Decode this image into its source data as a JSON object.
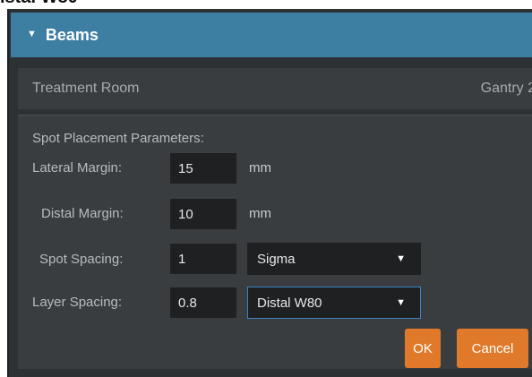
{
  "fragment": {
    "text": "istal W80"
  },
  "header": {
    "toggle_icon": "collapse-triangle-icon",
    "title": "Beams"
  },
  "room": {
    "label": "Treatment Room",
    "value": "Gantry 2"
  },
  "params": {
    "title": "Spot Placement Parameters:",
    "lateral_margin": {
      "label": "Lateral Margin:",
      "value": "15",
      "unit": "mm"
    },
    "distal_margin": {
      "label": "Distal Margin:",
      "value": "10",
      "unit": "mm"
    },
    "spot_spacing": {
      "label": "Spot Spacing:",
      "value": "1",
      "unit_selected": "Sigma"
    },
    "layer_spacing": {
      "label": "Layer Spacing:",
      "value": "0.8",
      "unit_selected": "Distal W80"
    }
  },
  "buttons": {
    "ok": "OK",
    "cancel": "Cancel"
  },
  "colors": {
    "header": "#3d7ea3",
    "accent": "#e07a2a",
    "focus": "#3d82c4"
  }
}
